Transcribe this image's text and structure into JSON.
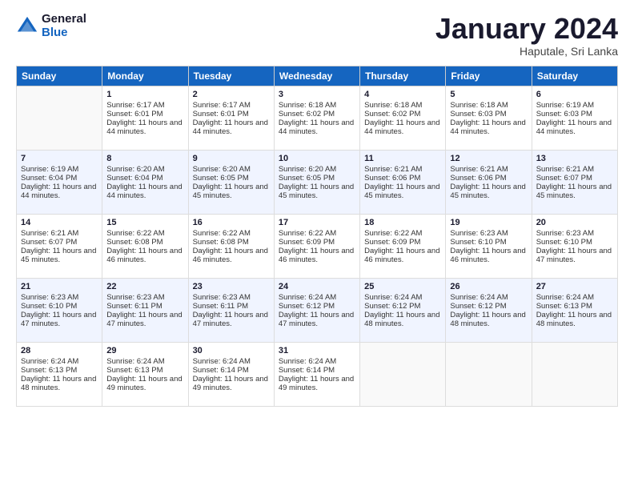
{
  "header": {
    "logo_general": "General",
    "logo_blue": "Blue",
    "month_title": "January 2024",
    "location": "Haputale, Sri Lanka"
  },
  "days_of_week": [
    "Sunday",
    "Monday",
    "Tuesday",
    "Wednesday",
    "Thursday",
    "Friday",
    "Saturday"
  ],
  "weeks": [
    [
      {
        "day": "",
        "sunrise": "",
        "sunset": "",
        "daylight": "",
        "empty": true
      },
      {
        "day": "1",
        "sunrise": "Sunrise: 6:17 AM",
        "sunset": "Sunset: 6:01 PM",
        "daylight": "Daylight: 11 hours and 44 minutes."
      },
      {
        "day": "2",
        "sunrise": "Sunrise: 6:17 AM",
        "sunset": "Sunset: 6:01 PM",
        "daylight": "Daylight: 11 hours and 44 minutes."
      },
      {
        "day": "3",
        "sunrise": "Sunrise: 6:18 AM",
        "sunset": "Sunset: 6:02 PM",
        "daylight": "Daylight: 11 hours and 44 minutes."
      },
      {
        "day": "4",
        "sunrise": "Sunrise: 6:18 AM",
        "sunset": "Sunset: 6:02 PM",
        "daylight": "Daylight: 11 hours and 44 minutes."
      },
      {
        "day": "5",
        "sunrise": "Sunrise: 6:18 AM",
        "sunset": "Sunset: 6:03 PM",
        "daylight": "Daylight: 11 hours and 44 minutes."
      },
      {
        "day": "6",
        "sunrise": "Sunrise: 6:19 AM",
        "sunset": "Sunset: 6:03 PM",
        "daylight": "Daylight: 11 hours and 44 minutes."
      }
    ],
    [
      {
        "day": "7",
        "sunrise": "Sunrise: 6:19 AM",
        "sunset": "Sunset: 6:04 PM",
        "daylight": "Daylight: 11 hours and 44 minutes."
      },
      {
        "day": "8",
        "sunrise": "Sunrise: 6:20 AM",
        "sunset": "Sunset: 6:04 PM",
        "daylight": "Daylight: 11 hours and 44 minutes."
      },
      {
        "day": "9",
        "sunrise": "Sunrise: 6:20 AM",
        "sunset": "Sunset: 6:05 PM",
        "daylight": "Daylight: 11 hours and 45 minutes."
      },
      {
        "day": "10",
        "sunrise": "Sunrise: 6:20 AM",
        "sunset": "Sunset: 6:05 PM",
        "daylight": "Daylight: 11 hours and 45 minutes."
      },
      {
        "day": "11",
        "sunrise": "Sunrise: 6:21 AM",
        "sunset": "Sunset: 6:06 PM",
        "daylight": "Daylight: 11 hours and 45 minutes."
      },
      {
        "day": "12",
        "sunrise": "Sunrise: 6:21 AM",
        "sunset": "Sunset: 6:06 PM",
        "daylight": "Daylight: 11 hours and 45 minutes."
      },
      {
        "day": "13",
        "sunrise": "Sunrise: 6:21 AM",
        "sunset": "Sunset: 6:07 PM",
        "daylight": "Daylight: 11 hours and 45 minutes."
      }
    ],
    [
      {
        "day": "14",
        "sunrise": "Sunrise: 6:21 AM",
        "sunset": "Sunset: 6:07 PM",
        "daylight": "Daylight: 11 hours and 45 minutes."
      },
      {
        "day": "15",
        "sunrise": "Sunrise: 6:22 AM",
        "sunset": "Sunset: 6:08 PM",
        "daylight": "Daylight: 11 hours and 46 minutes."
      },
      {
        "day": "16",
        "sunrise": "Sunrise: 6:22 AM",
        "sunset": "Sunset: 6:08 PM",
        "daylight": "Daylight: 11 hours and 46 minutes."
      },
      {
        "day": "17",
        "sunrise": "Sunrise: 6:22 AM",
        "sunset": "Sunset: 6:09 PM",
        "daylight": "Daylight: 11 hours and 46 minutes."
      },
      {
        "day": "18",
        "sunrise": "Sunrise: 6:22 AM",
        "sunset": "Sunset: 6:09 PM",
        "daylight": "Daylight: 11 hours and 46 minutes."
      },
      {
        "day": "19",
        "sunrise": "Sunrise: 6:23 AM",
        "sunset": "Sunset: 6:10 PM",
        "daylight": "Daylight: 11 hours and 46 minutes."
      },
      {
        "day": "20",
        "sunrise": "Sunrise: 6:23 AM",
        "sunset": "Sunset: 6:10 PM",
        "daylight": "Daylight: 11 hours and 47 minutes."
      }
    ],
    [
      {
        "day": "21",
        "sunrise": "Sunrise: 6:23 AM",
        "sunset": "Sunset: 6:10 PM",
        "daylight": "Daylight: 11 hours and 47 minutes."
      },
      {
        "day": "22",
        "sunrise": "Sunrise: 6:23 AM",
        "sunset": "Sunset: 6:11 PM",
        "daylight": "Daylight: 11 hours and 47 minutes."
      },
      {
        "day": "23",
        "sunrise": "Sunrise: 6:23 AM",
        "sunset": "Sunset: 6:11 PM",
        "daylight": "Daylight: 11 hours and 47 minutes."
      },
      {
        "day": "24",
        "sunrise": "Sunrise: 6:24 AM",
        "sunset": "Sunset: 6:12 PM",
        "daylight": "Daylight: 11 hours and 47 minutes."
      },
      {
        "day": "25",
        "sunrise": "Sunrise: 6:24 AM",
        "sunset": "Sunset: 6:12 PM",
        "daylight": "Daylight: 11 hours and 48 minutes."
      },
      {
        "day": "26",
        "sunrise": "Sunrise: 6:24 AM",
        "sunset": "Sunset: 6:12 PM",
        "daylight": "Daylight: 11 hours and 48 minutes."
      },
      {
        "day": "27",
        "sunrise": "Sunrise: 6:24 AM",
        "sunset": "Sunset: 6:13 PM",
        "daylight": "Daylight: 11 hours and 48 minutes."
      }
    ],
    [
      {
        "day": "28",
        "sunrise": "Sunrise: 6:24 AM",
        "sunset": "Sunset: 6:13 PM",
        "daylight": "Daylight: 11 hours and 48 minutes."
      },
      {
        "day": "29",
        "sunrise": "Sunrise: 6:24 AM",
        "sunset": "Sunset: 6:13 PM",
        "daylight": "Daylight: 11 hours and 49 minutes."
      },
      {
        "day": "30",
        "sunrise": "Sunrise: 6:24 AM",
        "sunset": "Sunset: 6:14 PM",
        "daylight": "Daylight: 11 hours and 49 minutes."
      },
      {
        "day": "31",
        "sunrise": "Sunrise: 6:24 AM",
        "sunset": "Sunset: 6:14 PM",
        "daylight": "Daylight: 11 hours and 49 minutes."
      },
      {
        "day": "",
        "sunrise": "",
        "sunset": "",
        "daylight": "",
        "empty": true
      },
      {
        "day": "",
        "sunrise": "",
        "sunset": "",
        "daylight": "",
        "empty": true
      },
      {
        "day": "",
        "sunrise": "",
        "sunset": "",
        "daylight": "",
        "empty": true
      }
    ]
  ]
}
